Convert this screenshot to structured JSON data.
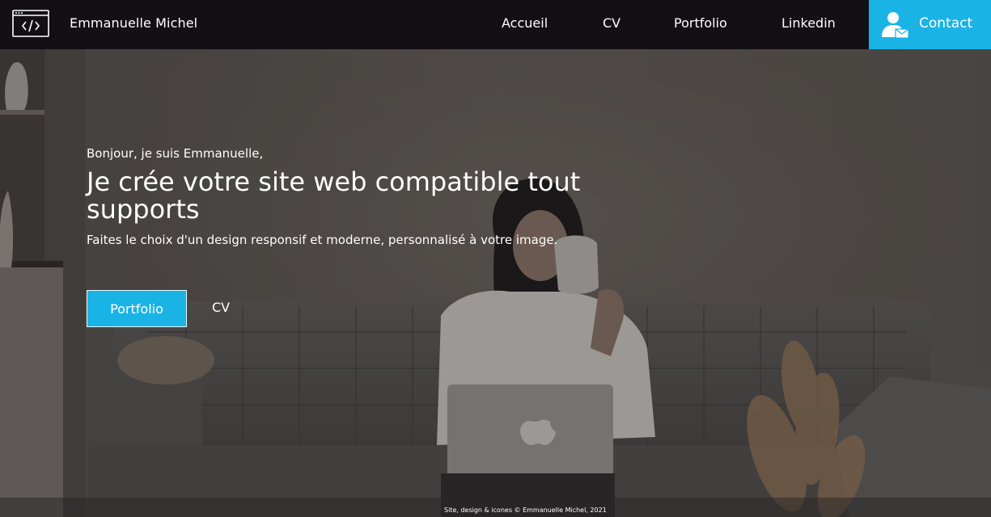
{
  "header": {
    "brand": "Emmanuelle Michel",
    "logo_icon": "code-window-icon",
    "nav": [
      {
        "label": "Accueil"
      },
      {
        "label": "CV"
      },
      {
        "label": "Portfolio"
      },
      {
        "label": "Linkedin"
      }
    ],
    "contact": {
      "label": "Contact",
      "icon": "user-mail-icon"
    }
  },
  "hero": {
    "greeting": "Bonjour, je suis Emmanuelle,",
    "headline": "Je crée votre site web compatible tout supports",
    "subline": "Faites le choix d'un design responsif et moderne, personnalisé à votre image.",
    "primary_button": "Portfolio",
    "secondary_button": "CV"
  },
  "footer": {
    "credit": "Site, design & icones © Emmanuelle Michel, 2021"
  },
  "colors": {
    "header_bg": "#121014",
    "accent": "#1ab3e6",
    "text": "#ffffff"
  }
}
